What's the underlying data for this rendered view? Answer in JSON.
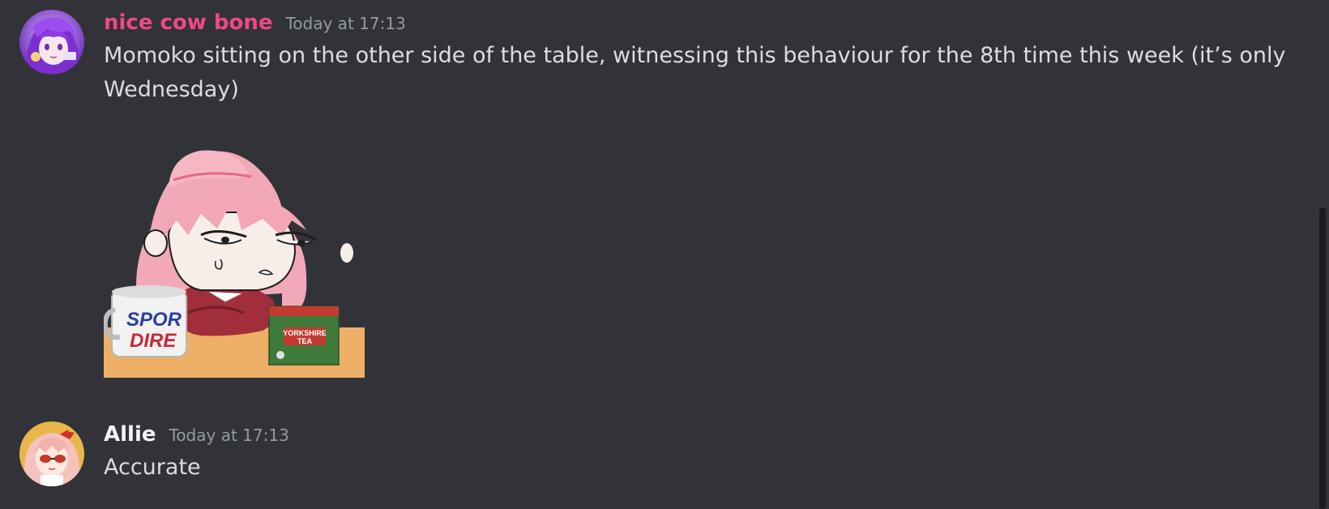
{
  "messages": [
    {
      "username": "nice cow bone",
      "timestamp": "Today at 17:13",
      "text": "Momoko sitting on the other side of the table, witnessing this behaviour for the 8th time this week (it’s only Wednesday)",
      "username_color": "#f0478a",
      "attachment": {
        "type": "sticker",
        "mug_text": "SPOR DIRE",
        "box_text": "YORKSHIRE TEA"
      }
    },
    {
      "username": "Allie",
      "timestamp": "Today at 17:13",
      "text": "Accurate",
      "username_color": "#f2f3f5"
    }
  ]
}
